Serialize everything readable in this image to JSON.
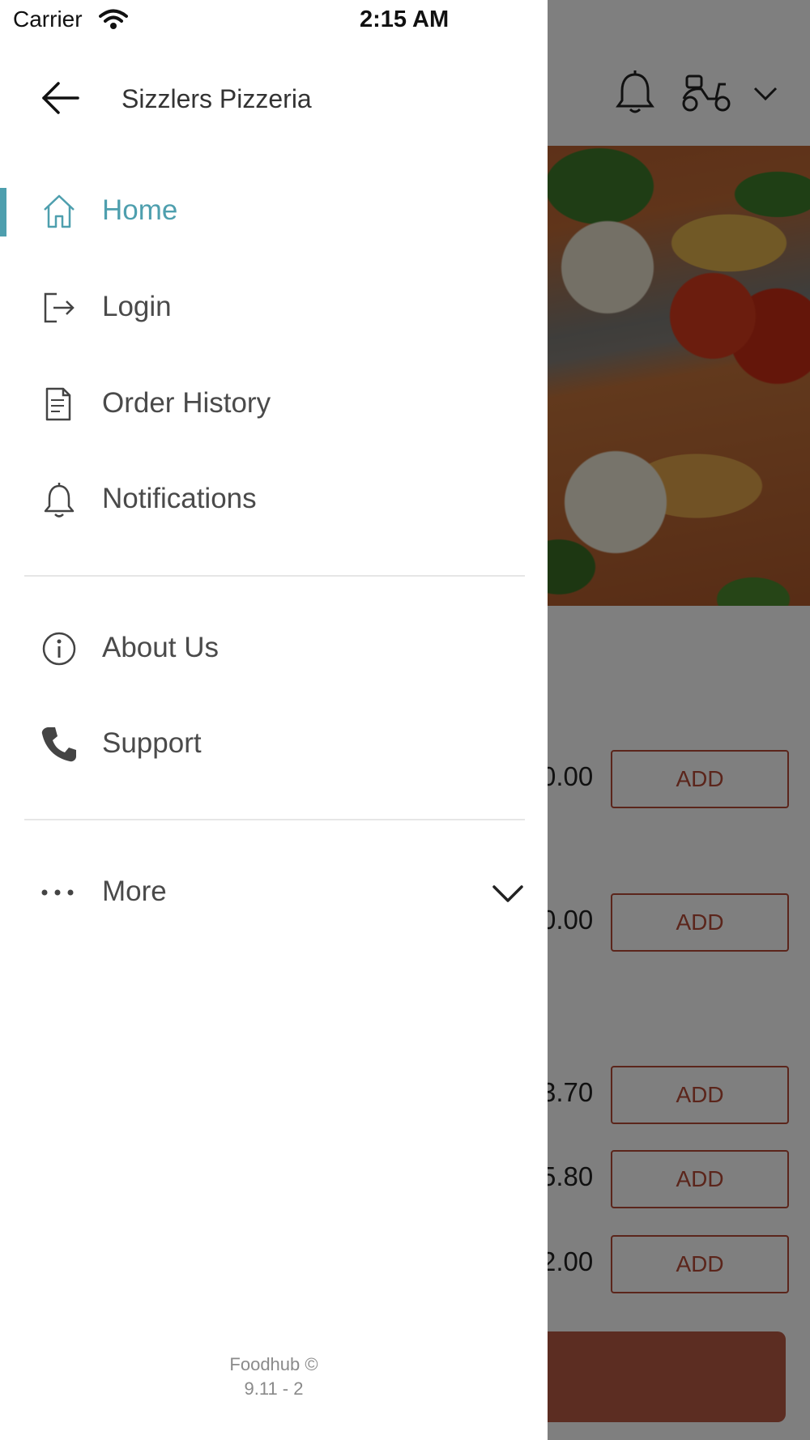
{
  "status_bar": {
    "carrier": "Carrier",
    "time": "2:15 AM"
  },
  "drawer": {
    "store_name": "Sizzlers Pizzeria",
    "items": [
      {
        "label": "Home",
        "icon": "home-icon",
        "active": true
      },
      {
        "label": "Login",
        "icon": "login-icon"
      },
      {
        "label": "Order History",
        "icon": "receipt-icon"
      },
      {
        "label": "Notifications",
        "icon": "bell-icon"
      },
      {
        "label": "About Us",
        "icon": "info-icon"
      },
      {
        "label": "Support",
        "icon": "phone-icon"
      },
      {
        "label": "More",
        "icon": "ellipsis-icon"
      }
    ],
    "footer": {
      "line1": "Foodhub ©",
      "line2": "9.11 - 2"
    }
  },
  "background_menu": {
    "rows": [
      {
        "price": "0.00",
        "button": "ADD"
      },
      {
        "price": "0.00",
        "button": "ADD"
      },
      {
        "price": "3.70",
        "button": "ADD"
      },
      {
        "price": "5.80",
        "button": "ADD"
      },
      {
        "price": "2.00",
        "button": "ADD"
      }
    ]
  },
  "colors": {
    "accent": "#4e9fae",
    "add_button": "#b64a36",
    "scrim": "rgba(0,0,0,0.5)"
  }
}
